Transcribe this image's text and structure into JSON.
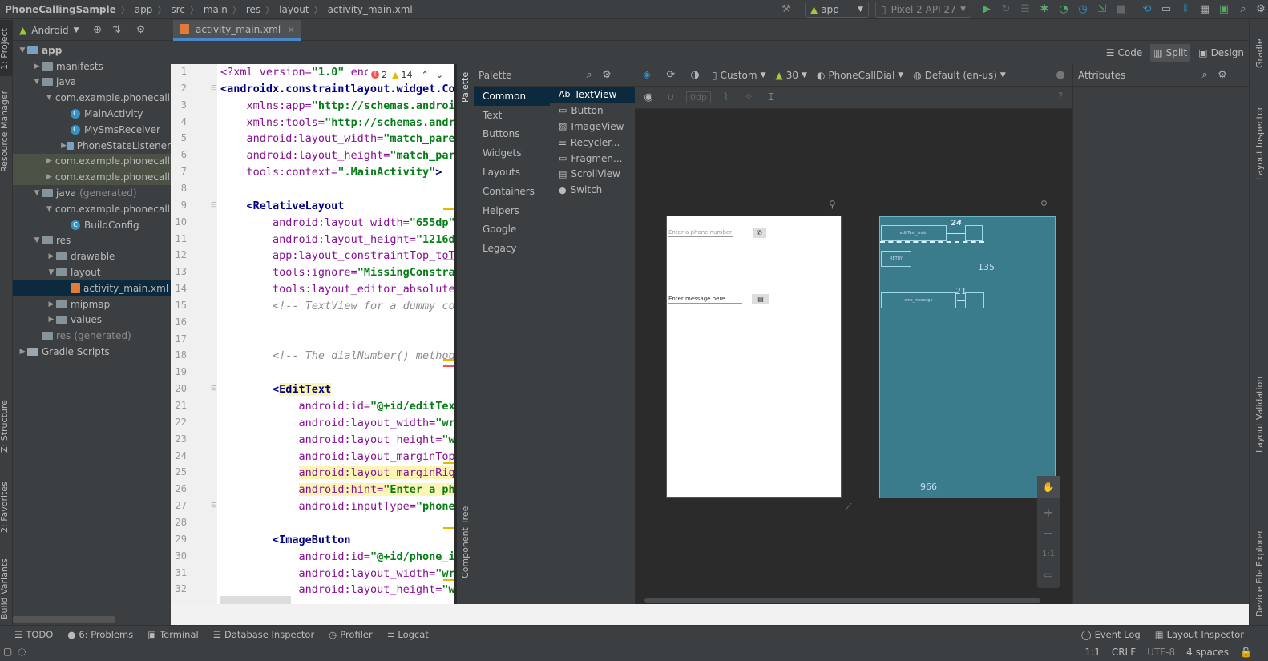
{
  "breadcrumbs": [
    "PhoneCallingSample",
    "app",
    "src",
    "main",
    "res",
    "layout",
    "activity_main.xml"
  ],
  "toolbar": {
    "run_config": "app",
    "device": "Pixel 2 API 27"
  },
  "left_strip": [
    "1: Project",
    "Resource Manager",
    "Z: Structure",
    "2: Favorites",
    "Build Variants"
  ],
  "project": {
    "view": "Android",
    "tree": [
      {
        "label": "app",
        "depth": 0,
        "arrow": "down",
        "icon": "module",
        "bold": true
      },
      {
        "label": "manifests",
        "depth": 1,
        "arrow": "right",
        "icon": "folder"
      },
      {
        "label": "java",
        "depth": 1,
        "arrow": "down",
        "icon": "folder"
      },
      {
        "label": "com.example.phonecallingsample",
        "depth": 2,
        "arrow": "down",
        "icon": "package"
      },
      {
        "label": "MainActivity",
        "depth": 3,
        "arrow": "",
        "icon": "class"
      },
      {
        "label": "MySmsReceiver",
        "depth": 3,
        "arrow": "",
        "icon": "class"
      },
      {
        "label": "PhoneStateListener",
        "depth": 3,
        "arrow": "right",
        "icon": "classpkg"
      },
      {
        "label": "com.example.phonecallingsample",
        "depth": 2,
        "arrow": "right",
        "icon": "package",
        "hl": true
      },
      {
        "label": "com.example.phonecallingsample",
        "depth": 2,
        "arrow": "right",
        "icon": "package",
        "hl": true
      },
      {
        "label": "java",
        "depth": 1,
        "arrow": "down",
        "icon": "folder",
        "suffix": "(generated)"
      },
      {
        "label": "com.example.phonecallingsample",
        "depth": 2,
        "arrow": "down",
        "icon": "package"
      },
      {
        "label": "BuildConfig",
        "depth": 3,
        "arrow": "",
        "icon": "class"
      },
      {
        "label": "res",
        "depth": 1,
        "arrow": "down",
        "icon": "folder"
      },
      {
        "label": "drawable",
        "depth": 2,
        "arrow": "right",
        "icon": "folder"
      },
      {
        "label": "layout",
        "depth": 2,
        "arrow": "down",
        "icon": "folder"
      },
      {
        "label": "activity_main.xml",
        "depth": 3,
        "arrow": "",
        "icon": "xml",
        "sel": true
      },
      {
        "label": "mipmap",
        "depth": 2,
        "arrow": "right",
        "icon": "folder"
      },
      {
        "label": "values",
        "depth": 2,
        "arrow": "right",
        "icon": "folder"
      },
      {
        "label": "res",
        "depth": 1,
        "arrow": "",
        "icon": "folder",
        "suffix": "(generated)"
      },
      {
        "label": "Gradle Scripts",
        "depth": 0,
        "arrow": "right",
        "icon": "gradle"
      }
    ]
  },
  "editor_tab": "activity_main.xml",
  "inspections": {
    "errors": "2",
    "warnings": "14"
  },
  "code_lines": [
    {
      "n": "1",
      "html": "<span class='a'>&lt;?xml version=</span><span class='v'>\"1.0\"</span><span class='a'> enc</span>"
    },
    {
      "n": "2",
      "html": "<span class='t'>&lt;androidx.constraintlayout.widget.Con</span>"
    },
    {
      "n": "3",
      "html": "    <span class='a'>xmlns:app=</span><span class='v'>\"http://schemas.android</span>"
    },
    {
      "n": "4",
      "html": "    <span class='a'>xmlns:tools=</span><span class='v'>\"http://schemas.andro</span>"
    },
    {
      "n": "5",
      "html": "    <span class='a'>android:layout_width=</span><span class='v'>\"match_paren</span>"
    },
    {
      "n": "6",
      "html": "    <span class='a'>android:layout_height=</span><span class='v'>\"match_pare</span>"
    },
    {
      "n": "7",
      "html": "    <span class='a'>tools:context=</span><span class='v'>\".MainActivity\"</span><span class='t'>&gt;</span>"
    },
    {
      "n": "8",
      "html": ""
    },
    {
      "n": "9",
      "html": "    <span class='t'>&lt;RelativeLayout</span>"
    },
    {
      "n": "10",
      "html": "        <span class='a'>android:layout_width=</span><span class='v'>\"655dp\"</span>"
    },
    {
      "n": "11",
      "html": "        <span class='a'>android:layout_height=</span><span class='v'>\"1216dp</span>"
    },
    {
      "n": "12",
      "html": "        <span class='a'>app:layout_constraintTop_toTo</span>"
    },
    {
      "n": "13",
      "html": "        <span class='a'>tools:ignore=</span><span class='v'>\"MissingConstrai</span>"
    },
    {
      "n": "14",
      "html": "        <span class='a'>tools:layout_editor_absoluteX</span>"
    },
    {
      "n": "15",
      "html": "        <span class='cm'>&lt;!-- TextView for a dummy con</span>"
    },
    {
      "n": "16",
      "html": ""
    },
    {
      "n": "17",
      "html": ""
    },
    {
      "n": "18",
      "html": "        <span class='cm'>&lt;!-- The dialNumber() method</span>"
    },
    {
      "n": "19",
      "html": ""
    },
    {
      "n": "20",
      "html": "        <span class='t'>&lt;<span class='hlt'>EditText</span></span>"
    },
    {
      "n": "21",
      "html": "            <span class='a'>android:id=</span><span class='v'>\"@+id/editText</span>"
    },
    {
      "n": "22",
      "html": "            <span class='a'>android:layout_width=</span><span class='v'>\"wra</span>"
    },
    {
      "n": "23",
      "html": "            <span class='a'>android:layout_height=</span><span class='v'>\"wr</span>"
    },
    {
      "n": "24",
      "html": "            <span class='a'>android:layout_marginTop=</span>"
    },
    {
      "n": "25",
      "html": "            <span class='a hlt'>android:layout_marginRigh</span>"
    },
    {
      "n": "26",
      "html": "            <span class='a hlt'>android:hint=</span><span class='v hlt'>\"Enter a pho</span>"
    },
    {
      "n": "27",
      "html": "            <span class='a'>android:inputType=</span><span class='v'>\"phone\"</span>"
    },
    {
      "n": "28",
      "html": ""
    },
    {
      "n": "29",
      "html": "        <span class='t'>&lt;ImageButton</span>"
    },
    {
      "n": "30",
      "html": "            <span class='a'>android:id=</span><span class='v'>\"@+id/phone_ic</span>"
    },
    {
      "n": "31",
      "html": "            <span class='a'>android:layout_width=</span><span class='v'>\"wra</span>"
    },
    {
      "n": "32",
      "html": "            <span class='a'>android:layout_height=</span><span class='v'>\"wr</span>"
    }
  ],
  "view_modes": [
    "Code",
    "Split",
    "Design"
  ],
  "palette": {
    "title": "Palette",
    "categories": [
      "Common",
      "Text",
      "Buttons",
      "Widgets",
      "Layouts",
      "Containers",
      "Helpers",
      "Google",
      "Legacy"
    ],
    "items": [
      "TextView",
      "Button",
      "ImageView",
      "Recycler...",
      "Fragmen...",
      "ScrollView",
      "Switch"
    ]
  },
  "vertical_tabs": {
    "palette": "Palette",
    "component_tree": "Component Tree"
  },
  "design_toolbar": {
    "device": "Custom",
    "api": "30",
    "theme": "PhoneCallDial",
    "locale": "Default (en-us)",
    "margin": "0dp"
  },
  "preview": {
    "phone_hint": "Enter a phone number",
    "message_hint": "Enter message here"
  },
  "blueprint": {
    "edit_label": "editText_main",
    "retry_label": "RETRY",
    "sms_label": "sms_message",
    "dim_24": "24",
    "dim_135": "135",
    "dim_21": "21",
    "dim_966": "966"
  },
  "zoom": {
    "one_to_one": "1:1"
  },
  "attributes_title": "Attributes",
  "right_strip": [
    "Gradle",
    "Layout Inspector",
    "Layout Validation",
    "Device File Explorer"
  ],
  "bottom_tools": [
    "TODO",
    "6: Problems",
    "Terminal",
    "Database Inspector",
    "Profiler",
    "Logcat"
  ],
  "bottom_right": [
    "Event Log",
    "Layout Inspector"
  ],
  "status": {
    "position": "1:1",
    "line_sep": "CRLF",
    "encoding": "UTF-8",
    "indent": "4 spaces"
  }
}
